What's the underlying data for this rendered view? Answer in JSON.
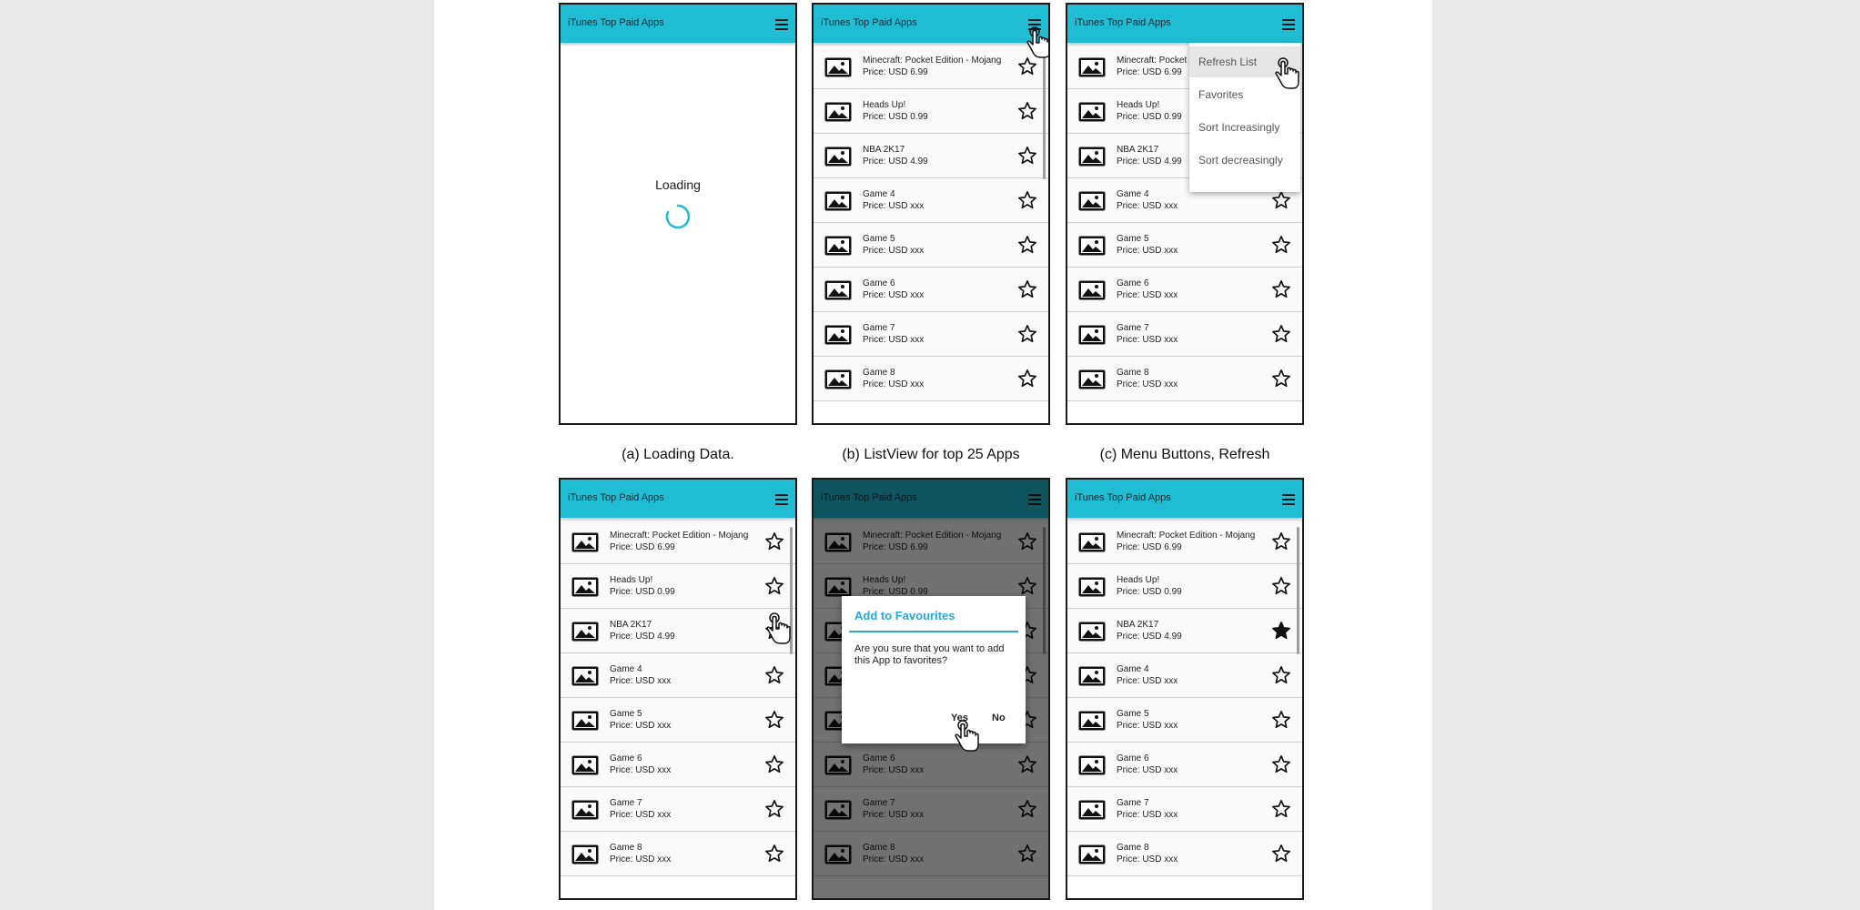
{
  "app_title": "iTunes Top Paid Apps",
  "loading_text": "Loading",
  "captions": {
    "a": "(a) Loading Data.",
    "b": "(b) ListView for top 25 Apps",
    "c": "(c) Menu Buttons, Refresh"
  },
  "apps": [
    {
      "name": "Minecraft: Pocket Edition - Mojang",
      "price": "Price: USD 6.99"
    },
    {
      "name": "Heads Up!",
      "price": "Price: USD 0.99"
    },
    {
      "name": "NBA 2K17",
      "price": "Price: USD 4.99"
    },
    {
      "name": "Game 4",
      "price": "Price: USD xxx"
    },
    {
      "name": "Game 5",
      "price": "Price: USD xxx"
    },
    {
      "name": "Game 6",
      "price": "Price: USD xxx"
    },
    {
      "name": "Game 7",
      "price": "Price: USD xxx"
    },
    {
      "name": "Game 8",
      "price": "Price: USD xxx"
    }
  ],
  "menu_items": [
    "Refresh List",
    "Favorites",
    "Sort Increasingly",
    "Sort decreasingly"
  ],
  "dialog": {
    "title": "Add to Favourites",
    "message": "Are you sure that you want to add this App to favorites?",
    "yes": "Yes",
    "no": "No"
  },
  "favorited_index_panel_f": 2,
  "colors": {
    "appbar": "#1fbcd3",
    "dialog_accent": "#2aa9d8"
  }
}
